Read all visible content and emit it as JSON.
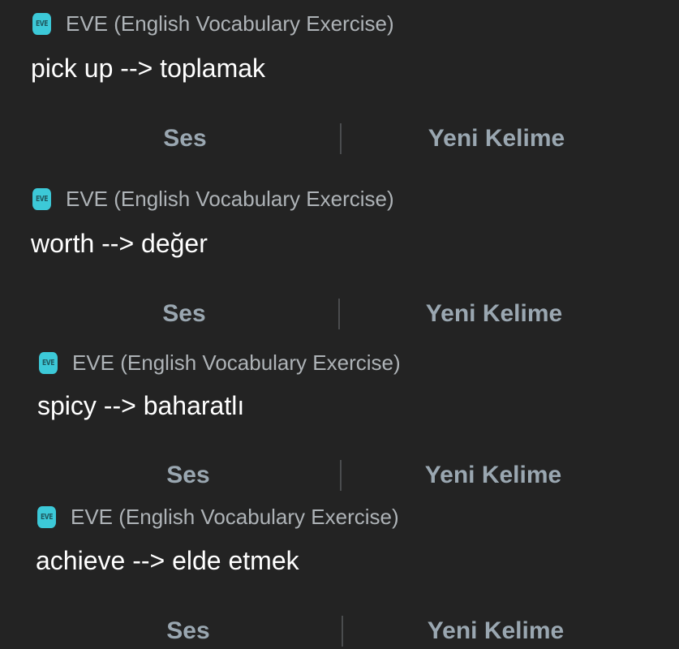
{
  "app": {
    "icon_label": "EVE",
    "name": "EVE (English Vocabulary Exercise)"
  },
  "notifications": [
    {
      "title": "pick up --> toplamak",
      "actions": {
        "sound": "Ses",
        "new_word": "Yeni Kelime"
      }
    },
    {
      "title": "worth --> değer",
      "actions": {
        "sound": "Ses",
        "new_word": "Yeni Kelime"
      }
    },
    {
      "title": "spicy --> baharatlı",
      "actions": {
        "sound": "Ses",
        "new_word": "Yeni Kelime"
      }
    },
    {
      "title": "achieve --> elde etmek",
      "actions": {
        "sound": "Ses",
        "new_word": "Yeni Kelime"
      }
    }
  ],
  "colors": {
    "background": "#232323",
    "icon_bg": "#3cc9d8",
    "app_name": "#aeb3b7",
    "title": "#ffffff",
    "action_text": "#9aa7b1",
    "divider": "#4a4c4e"
  },
  "icons": {
    "app_icon": "eve-app-icon"
  }
}
